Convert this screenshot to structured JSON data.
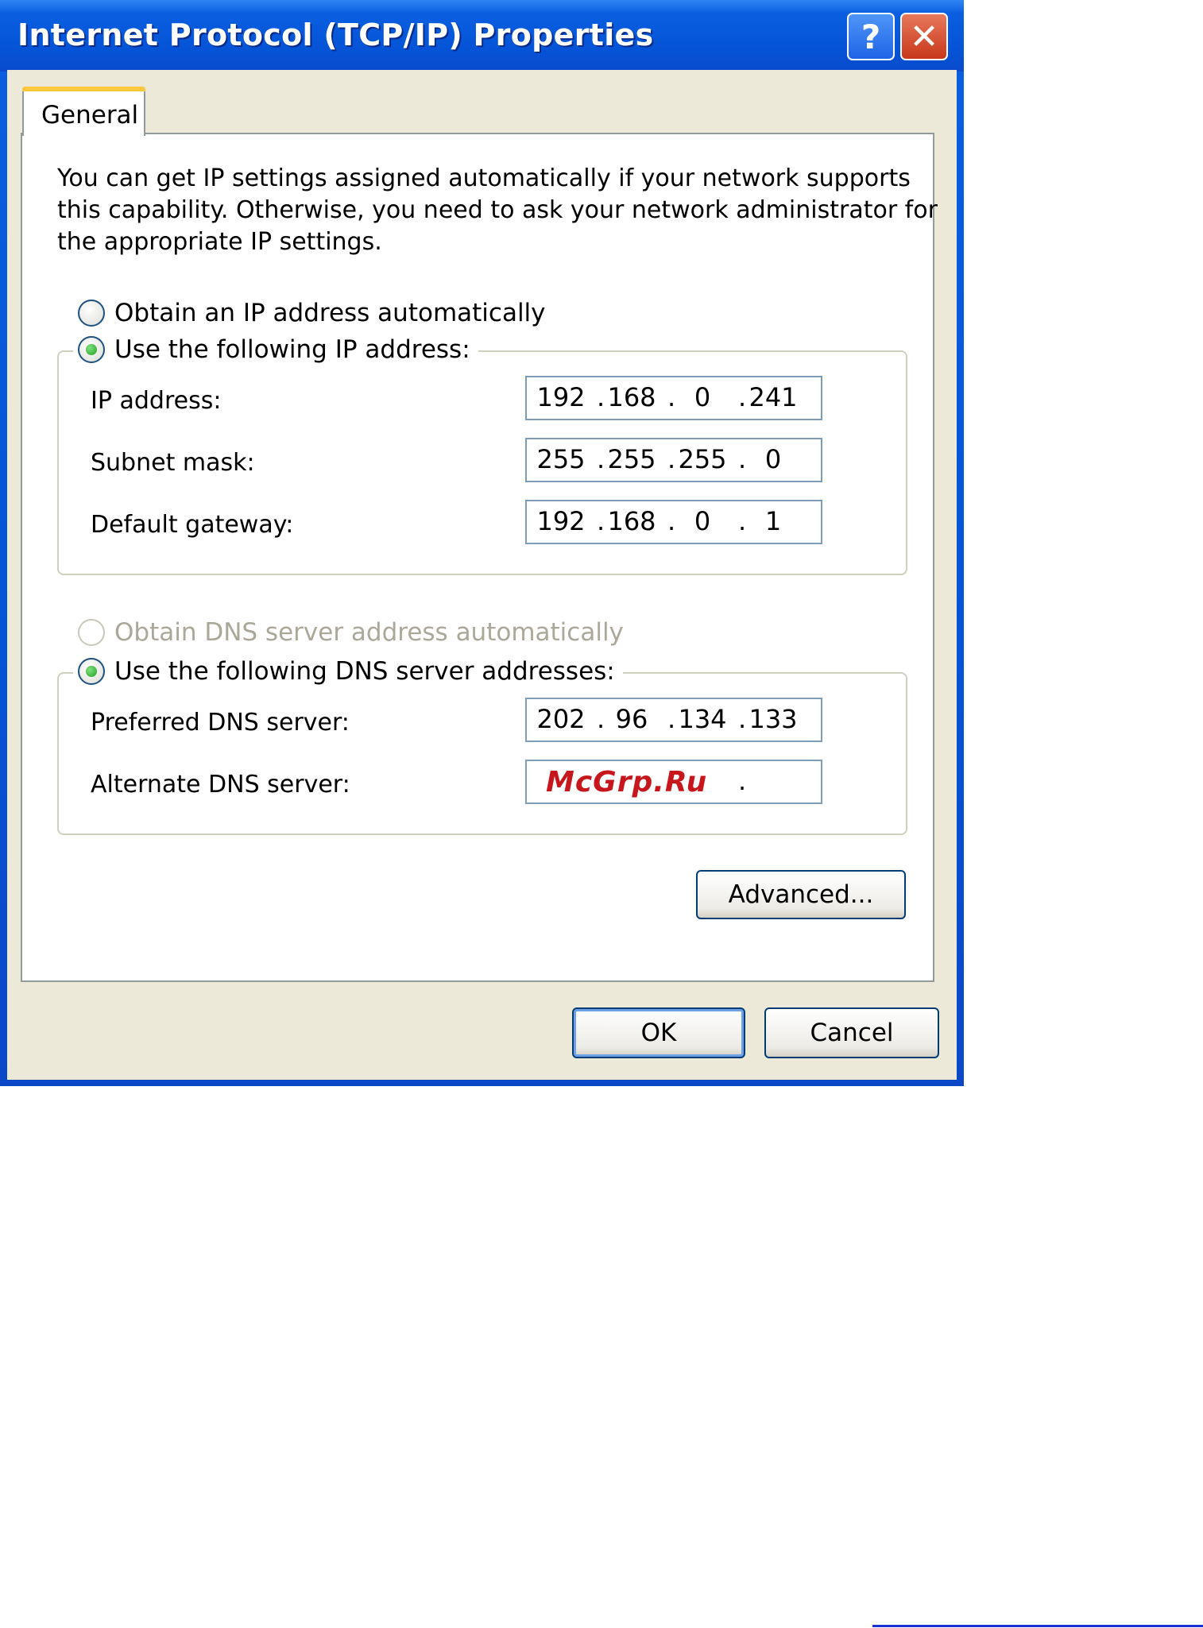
{
  "window": {
    "title": "Internet Protocol (TCP/IP) Properties",
    "help_label": "?",
    "close_label": "✕"
  },
  "tabs": [
    {
      "label": "General"
    }
  ],
  "intro_lines": [
    "You can get IP settings assigned automatically if your network supports",
    "this capability. Otherwise, you need to ask your network administrator for",
    "the appropriate IP settings."
  ],
  "ip_section": {
    "auto_label": "Obtain an IP address automatically",
    "manual_label": "Use the following IP address:",
    "fields": [
      {
        "label": "IP address:",
        "octets": [
          "192",
          "168",
          "0",
          "241"
        ]
      },
      {
        "label": "Subnet mask:",
        "octets": [
          "255",
          "255",
          "255",
          "0"
        ]
      },
      {
        "label": "Default gateway:",
        "octets": [
          "192",
          "168",
          "0",
          "1"
        ]
      }
    ]
  },
  "dns_section": {
    "auto_label": "Obtain DNS server address automatically",
    "manual_label": "Use the following DNS server addresses:",
    "fields": [
      {
        "label": "Preferred DNS server:",
        "octets": [
          "202",
          "96",
          "134",
          "133"
        ]
      },
      {
        "label": "Alternate DNS server:",
        "octets": [
          "",
          "",
          "",
          ""
        ]
      }
    ]
  },
  "watermark": "McGrp.Ru",
  "buttons": {
    "advanced": "Advanced...",
    "ok": "OK",
    "cancel": "Cancel"
  }
}
